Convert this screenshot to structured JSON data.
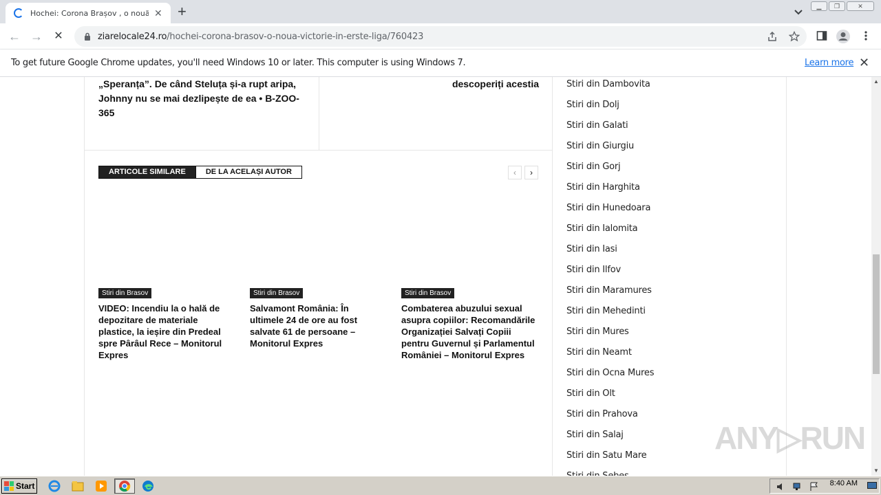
{
  "browser": {
    "tab_title": "Hochei: Corona Brașov , o nouă victorie în Erste Liga",
    "tab_close": "✕",
    "new_tab": "+",
    "url_domain": "ziarelocale24.ro",
    "url_path": "/hochei-corona-brasov-o-noua-victorie-in-erste-liga/760423",
    "back": "←",
    "forward": "→",
    "stop": "✕",
    "window_buttons": [
      "▁",
      "❐",
      "✕"
    ]
  },
  "infobar": {
    "message": "To get future Google Chrome updates, you'll need Windows 10 or later. This computer is using Windows 7.",
    "link": "Learn more",
    "close": "✕"
  },
  "previous_articles": {
    "left_text": "„Speranța”. De când Steluța și-a rupt aripa, Johnny nu se mai dezlipește de ea • B-ZOO-365",
    "right_text": "descoperiți acestia"
  },
  "related": {
    "tabs": [
      "ARTICOLE SIMILARE",
      "DE LA ACELAȘI AUTOR"
    ],
    "prev": "‹",
    "next": "›",
    "cards": [
      {
        "category": "Stiri din Brasov",
        "title": "VIDEO: Incendiu la o hală de depozitare de materiale plastice, la ieșire din Predeal spre Pârâul Rece – Monitorul Expres"
      },
      {
        "category": "Stiri din Brasov",
        "title": "Salvamont România: În ultimele 24 de ore au fost salvate 61 de persoane – Monitorul Expres"
      },
      {
        "category": "Stiri din Brasov",
        "title": "Combaterea abuzului sexual asupra copiilor: Recomandările Organizației Salvați Copiii pentru Guvernul și Parlamentul României – Monitorul Expres"
      }
    ]
  },
  "sidebar": {
    "items": [
      "Stiri din Dambovita",
      "Stiri din Dolj",
      "Stiri din Galati",
      "Stiri din Giurgiu",
      "Stiri din Gorj",
      "Stiri din Harghita",
      "Stiri din Hunedoara",
      "Stiri din Ialomita",
      "Stiri din Iasi",
      "Stiri din Ilfov",
      "Stiri din Maramures",
      "Stiri din Mehedinti",
      "Stiri din Mures",
      "Stiri din Neamt",
      "Stiri din Ocna Mures",
      "Stiri din Olt",
      "Stiri din Prahova",
      "Stiri din Salaj",
      "Stiri din Satu Mare",
      "Stiri din Sebes"
    ]
  },
  "watermark": "ANY▷RUN",
  "taskbar": {
    "start": "Start",
    "clock": "8:40 AM"
  }
}
